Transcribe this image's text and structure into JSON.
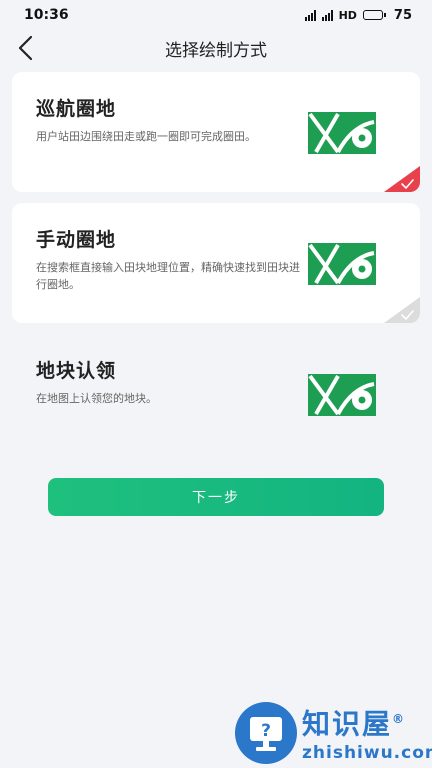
{
  "status_bar": {
    "time": "10:36",
    "network": "HD",
    "battery": "75",
    "battery_fraction": 0.75
  },
  "header": {
    "title": "选择绘制方式",
    "back_icon": "chevron-left-icon"
  },
  "options": [
    {
      "title": "巡航圈地",
      "description": "用户站田边围绕田走或跑一圈即可完成圈田。",
      "icon": "field-map-icon",
      "selected": true,
      "check_color": "#e8414b"
    },
    {
      "title": "手动圈地",
      "description": "在搜索框直接输入田块地理位置，精确快速找到田块进行圈地。",
      "icon": "field-map-icon",
      "selected": false,
      "check_color": "#dcdcdc"
    },
    {
      "title": "地块认领",
      "description": "在地图上认领您的地块。",
      "icon": "field-map-icon",
      "selected": false
    }
  ],
  "next_button": {
    "label": "下一步",
    "color": "#1cbc7e"
  },
  "watermark": {
    "name_cn": "知识屋",
    "registered": "®",
    "name_en": "zhishiwu.com",
    "color": "#2b77c9"
  },
  "colors": {
    "brand_green": "#1e9e52",
    "background": "#f3f4f7"
  }
}
